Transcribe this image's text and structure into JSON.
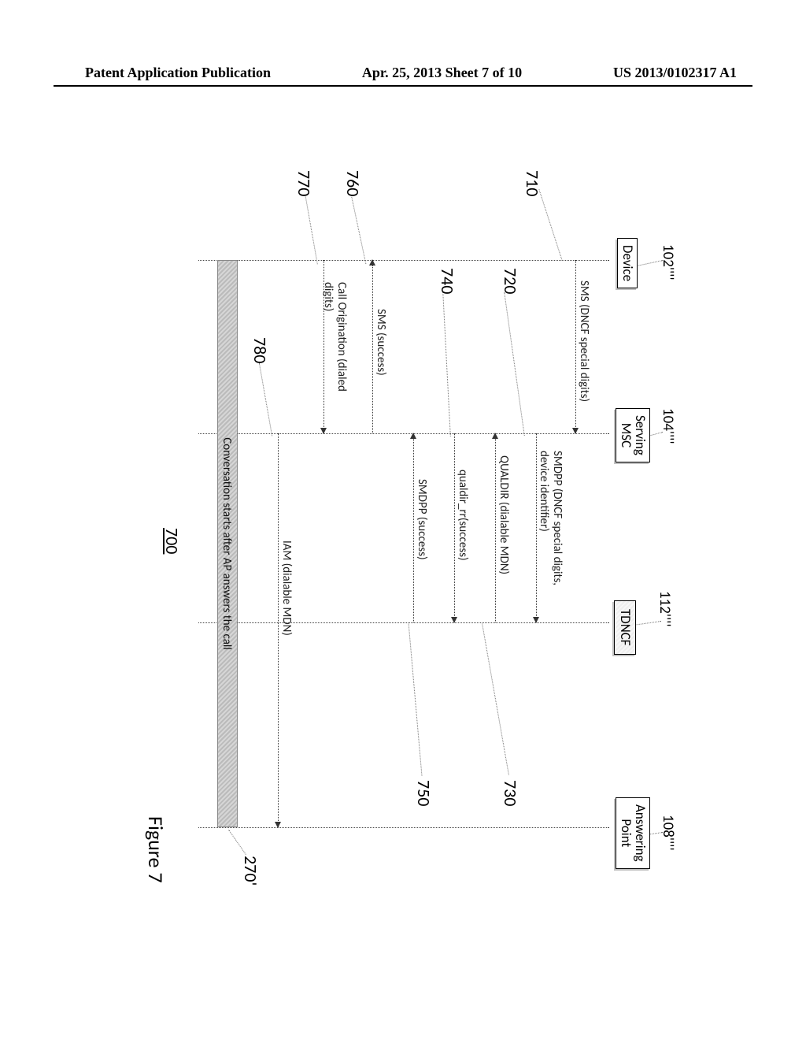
{
  "header": {
    "left": "Patent Application Publication",
    "center": "Apr. 25, 2013  Sheet 7 of 10",
    "right": "US 2013/0102317 A1"
  },
  "labels": {
    "l102": "102''''",
    "l104": "104''''",
    "l112": "112''''",
    "l108": "108''''"
  },
  "boxes": {
    "device": "Device",
    "msc": "Serving\nMSC",
    "tdncf": "TDNCF",
    "ap": "Answering\nPoint"
  },
  "messages": {
    "m710": "SMS (DNCF special digits)",
    "m720": "SMDPP (DNCF special digits,\ndevice identifier)",
    "m730": "QUALDIR (dialable MDN)",
    "m740": "qualdir_rr(success)",
    "m750": "SMDPP (success)",
    "m760": "SMS (success)",
    "m770": "Call Origination (dialed\ndigits)",
    "m780": "IAM (dialable MDN)"
  },
  "refs": {
    "r710": "710",
    "r720": "720",
    "r730": "730",
    "r740": "740",
    "r750": "750",
    "r760": "760",
    "r770": "770",
    "r780": "780",
    "r270": "270'"
  },
  "conv": "Conversation starts after AP answers the call",
  "figure": {
    "num": "700",
    "caption": "Figure 7"
  }
}
